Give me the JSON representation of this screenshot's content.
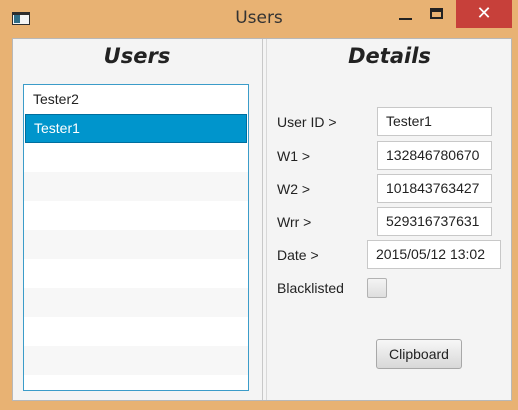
{
  "window": {
    "title": "Users",
    "close_glyph": "✕",
    "icons": {
      "app": "app-window-icon",
      "minimize": "minimize-icon",
      "maximize": "maximize-icon",
      "close": "close-icon"
    },
    "close_color": "#c7403a",
    "frame_color": "#e8b273"
  },
  "users_pane": {
    "heading": "Users",
    "items": [
      {
        "label": "Tester2",
        "selected": false
      },
      {
        "label": "Tester1",
        "selected": true
      }
    ],
    "selection_color": "#0095cc"
  },
  "details_pane": {
    "heading": "Details",
    "fields": {
      "user_id": {
        "label": "User ID >",
        "value": "Tester1"
      },
      "w1": {
        "label": "W1 >",
        "value": "132846780670"
      },
      "w2": {
        "label": "W2 >",
        "value": "101843763427"
      },
      "wrr": {
        "label": "Wrr >",
        "value": "529316737631"
      },
      "date": {
        "label": "Date >",
        "value": "2015/05/12 13:02"
      },
      "blacklisted": {
        "label": "Blacklisted",
        "checked": false
      }
    },
    "clipboard_button": {
      "label": "Clipboard"
    }
  }
}
